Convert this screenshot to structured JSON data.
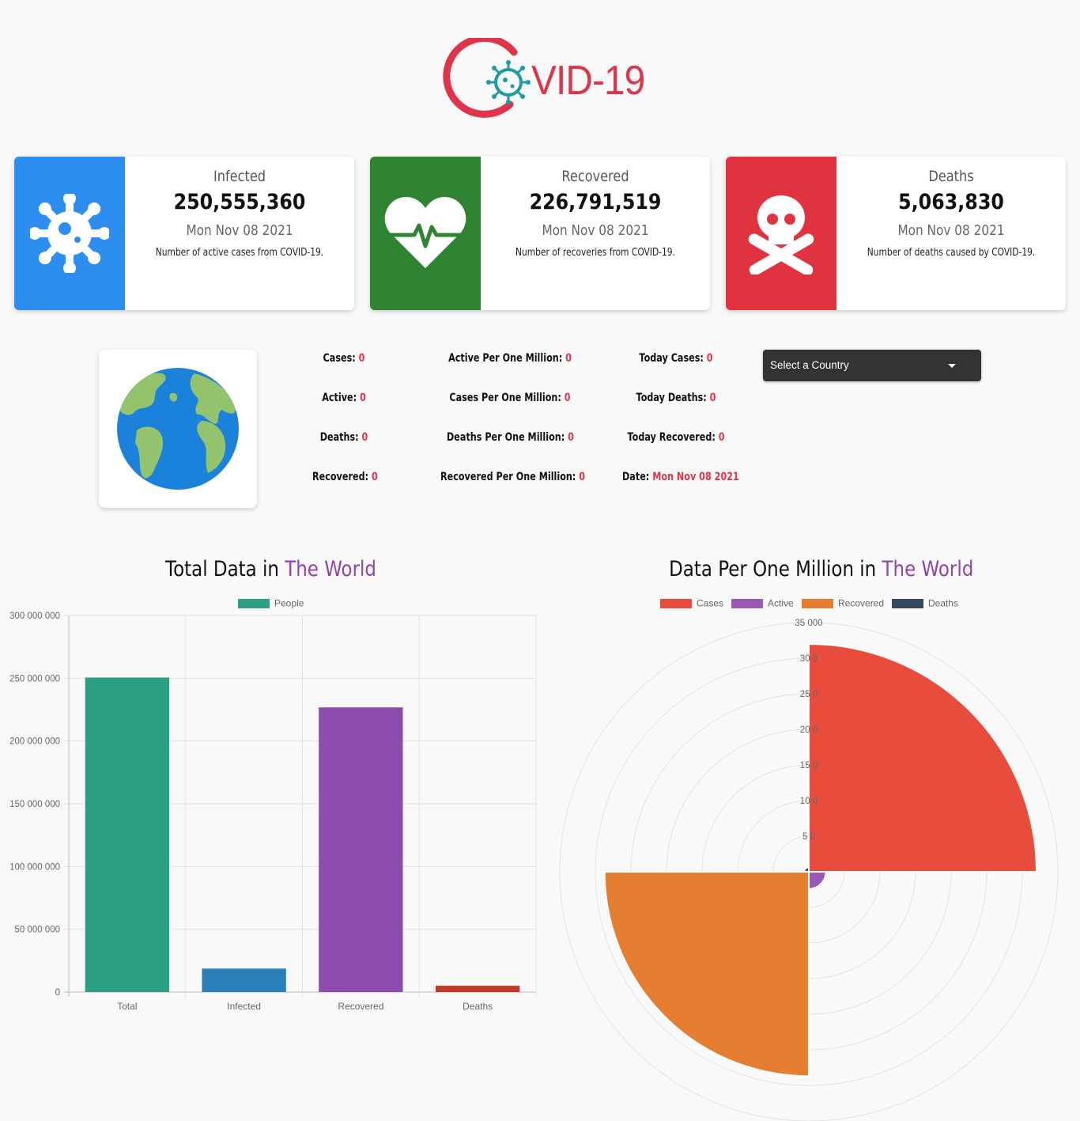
{
  "logo": {
    "text": "VID-19"
  },
  "cards": [
    {
      "title": "Infected",
      "value": "250,555,360",
      "date": "Mon Nov 08 2021",
      "description": "Number of active cases from COVID-19.",
      "color": "#2b8ef0",
      "icon": "virus-icon"
    },
    {
      "title": "Recovered",
      "value": "226,791,519",
      "date": "Mon Nov 08 2021",
      "description": "Number of recoveries from COVID-19.",
      "color": "#2e8430",
      "icon": "heartbeat-icon"
    },
    {
      "title": "Deaths",
      "value": "5,063,830",
      "date": "Mon Nov 08 2021",
      "description": "Number of deaths caused by COVID-19.",
      "color": "#e0333f",
      "icon": "skull-crossbones-icon"
    }
  ],
  "country_stats": {
    "cases": {
      "label": "Cases:",
      "value": "0"
    },
    "active": {
      "label": "Active:",
      "value": "0"
    },
    "deaths": {
      "label": "Deaths:",
      "value": "0"
    },
    "recovered": {
      "label": "Recovered:",
      "value": "0"
    },
    "active_per_million": {
      "label": "Active Per One Million:",
      "value": "0"
    },
    "cases_per_million": {
      "label": "Cases Per One Million:",
      "value": "0"
    },
    "deaths_per_million": {
      "label": "Deaths Per One Million:",
      "value": "0"
    },
    "recovered_per_million": {
      "label": "Recovered Per One Million:",
      "value": "0"
    },
    "today_cases": {
      "label": "Today Cases:",
      "value": "0"
    },
    "today_deaths": {
      "label": "Today Deaths:",
      "value": "0"
    },
    "today_recovered": {
      "label": "Today Recovered:",
      "value": "0"
    },
    "date": {
      "label": "Date:",
      "value": "Mon Nov 08 2021"
    }
  },
  "country_select": {
    "selected": "Select a Country"
  },
  "bar_title": {
    "prefix": "Total Data in ",
    "highlight": "The World"
  },
  "polar_title": {
    "prefix": "Data Per One Million in ",
    "highlight": "The World"
  },
  "chart_data": [
    {
      "type": "bar",
      "categories": [
        "Total",
        "Infected",
        "Recovered",
        "Deaths"
      ],
      "series": [
        {
          "name": "People",
          "values": [
            250555360,
            18700000,
            226791519,
            5063830
          ]
        }
      ],
      "colors": [
        "#2ba084",
        "#2980b9",
        "#8e4cad",
        "#c0392b"
      ],
      "legend_color": "#2ba084",
      "ylim": [
        0,
        300000000
      ],
      "yticks": [
        0,
        50000000,
        100000000,
        150000000,
        200000000,
        250000000,
        300000000
      ],
      "ytick_labels": [
        "0",
        "50 000 000",
        "100 000 000",
        "150 000 000",
        "200 000 000",
        "250 000 000",
        "300 000 000"
      ],
      "grid": true,
      "legend_position": "top"
    },
    {
      "type": "polarArea",
      "categories": [
        "Cases",
        "Active",
        "Recovered",
        "Deaths"
      ],
      "values": [
        32000,
        2400,
        28700,
        650
      ],
      "colors": [
        "#e74c3c",
        "#9b59b6",
        "#e67e32",
        "#34495e"
      ],
      "rlim": [
        0,
        35000
      ],
      "rticks": [
        5000,
        10000,
        15000,
        20000,
        25000,
        30000,
        35000
      ],
      "rtick_labels": [
        "5 0",
        "10 0",
        "15 0",
        "20 0",
        "25 0",
        "30 0",
        "35 000"
      ],
      "grid": true,
      "legend_position": "top"
    }
  ]
}
